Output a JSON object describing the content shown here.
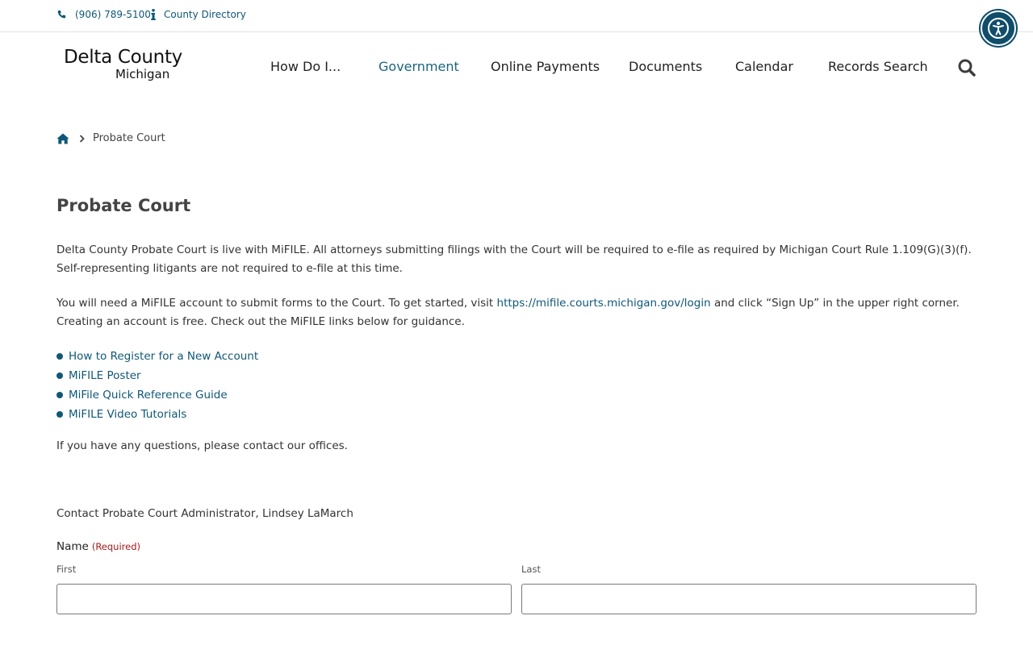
{
  "topbar": {
    "phone": "(906) 789-5100",
    "directory": "County Directory"
  },
  "logo": {
    "line1": "Delta County",
    "line2": "Michigan"
  },
  "nav": {
    "items": [
      {
        "label": "How Do I..."
      },
      {
        "label": "Government"
      },
      {
        "label": "Online Payments"
      },
      {
        "label": "Documents"
      },
      {
        "label": "Calendar"
      },
      {
        "label": "Records Search"
      }
    ],
    "active": "Government"
  },
  "breadcrumb": {
    "current": "Probate Court"
  },
  "main": {
    "title": "Probate Court",
    "paragraph1": "Delta County Probate Court is live with MiFILE.  All attorneys submitting filings with the Court will be required to e-file as required by Michigan Court Rule 1.109(G)(3)(f).  Self-representing litigants are not required to e-file at this time.",
    "paragraph2_before": "You will need a MiFILE account to submit forms to the Court. To get started, visit ",
    "paragraph2_link": "https://mifile.courts.michigan.gov/login",
    "paragraph2_after": " and click “Sign Up” in the upper right corner. Creating an account is free. Check out the MiFILE links below for guidance.",
    "links": [
      "How to Register for a New Account",
      "MiFILE Poster",
      "MiFile Quick Reference Guide",
      "MiFILE Video Tutorials"
    ],
    "paragraph3": "If you have any questions, please contact our offices.",
    "contact": "Contact Probate Court Administrator, Lindsey LaMarch"
  },
  "form": {
    "name_label": "Name",
    "required": "(Required)",
    "first_label": "First",
    "last_label": "Last",
    "first_value": "",
    "last_value": ""
  },
  "colors": {
    "accent": "#0f5777",
    "nav_active": "#1a6682",
    "required": "#a31a1a"
  }
}
